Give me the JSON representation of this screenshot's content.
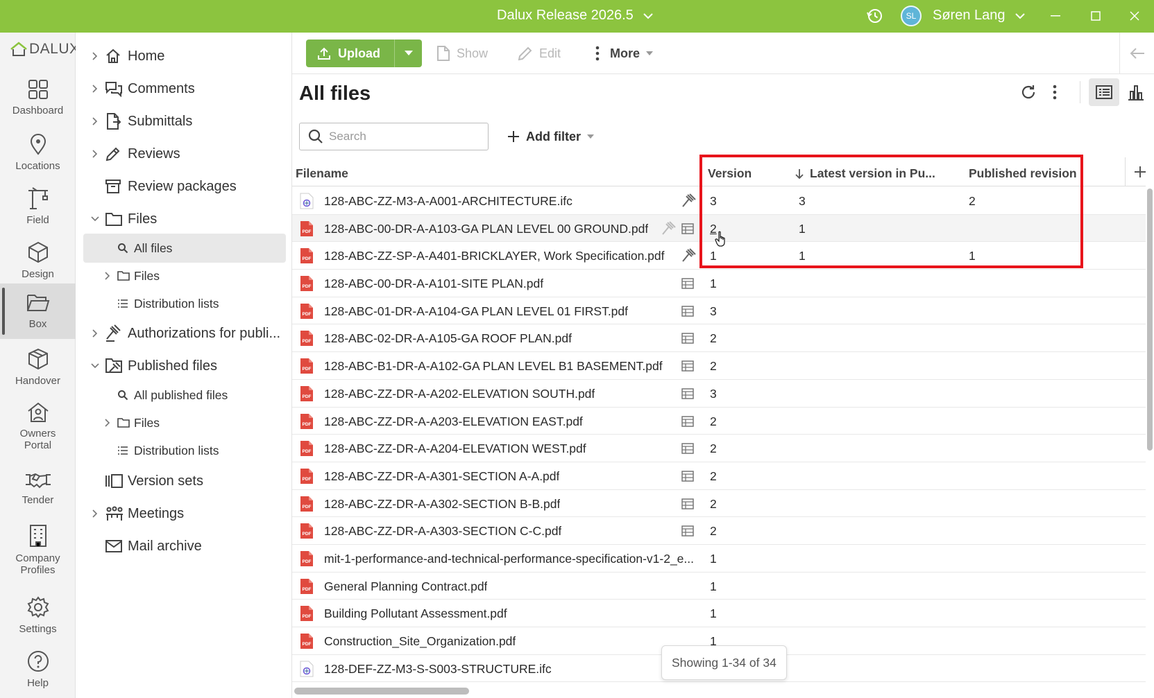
{
  "window": {
    "title": "Dalux Release 2026.5",
    "user_initials": "SL",
    "user_name": "Søren Lang"
  },
  "rail": {
    "logo_text": "DALUX",
    "items": [
      {
        "label": "Dashboard",
        "icon": "dashboard-icon"
      },
      {
        "label": "Locations",
        "icon": "location-pin-icon"
      },
      {
        "label": "Field",
        "icon": "crane-icon"
      },
      {
        "label": "Design",
        "icon": "cube-icon"
      },
      {
        "label": "Box",
        "icon": "folder-open-icon",
        "active": true
      },
      {
        "label": "Handover",
        "icon": "box-icon"
      },
      {
        "label": "Owners\nPortal",
        "icon": "house-user-icon"
      },
      {
        "label": "Tender",
        "icon": "handshake-icon"
      },
      {
        "label": "Company\nProfiles",
        "icon": "building-icon"
      },
      {
        "label": "Settings",
        "icon": "gear-icon"
      },
      {
        "label": "Help",
        "icon": "help-circle-icon"
      }
    ]
  },
  "tree": {
    "items": [
      {
        "label": "Home",
        "icon": "home-icon"
      },
      {
        "label": "Comments",
        "icon": "comments-icon"
      },
      {
        "label": "Submittals",
        "icon": "submittals-icon"
      },
      {
        "label": "Reviews",
        "icon": "pencil-icon"
      },
      {
        "label": "Review packages",
        "icon": "package-icon"
      },
      {
        "label": "Files",
        "icon": "folder-icon"
      },
      {
        "label": "All files",
        "icon": "search-icon"
      },
      {
        "label": "Files",
        "icon": "folder-icon"
      },
      {
        "label": "Distribution lists",
        "icon": "list-icon"
      },
      {
        "label": "Authorizations for publi...",
        "icon": "gavel-icon"
      },
      {
        "label": "Published files",
        "icon": "published-icon"
      },
      {
        "label": "All published files",
        "icon": "search-icon"
      },
      {
        "label": "Files",
        "icon": "folder-icon"
      },
      {
        "label": "Distribution lists",
        "icon": "list-icon"
      },
      {
        "label": "Version sets",
        "icon": "version-sets-icon"
      },
      {
        "label": "Meetings",
        "icon": "meetings-icon"
      },
      {
        "label": "Mail archive",
        "icon": "mail-icon"
      }
    ]
  },
  "toolbar": {
    "upload": "Upload",
    "show": "Show",
    "edit": "Edit",
    "more": "More"
  },
  "page": {
    "title": "All files",
    "search_placeholder": "Search",
    "add_filter": "Add filter"
  },
  "table": {
    "columns": {
      "filename": "Filename",
      "version": "Version",
      "latest": "Latest version in Pu...",
      "published": "Published revision"
    },
    "rows": [
      {
        "name": "128-ABC-ZZ-M3-A-A001-ARCHITECTURE.ifc",
        "type": "ifc",
        "version": "3",
        "latest": "3",
        "published": "2",
        "icons": [
          "gavel"
        ]
      },
      {
        "name": "128-ABC-00-DR-A-A103-GA PLAN LEVEL 00 GROUND.pdf",
        "type": "pdf",
        "version": "2",
        "latest": "1",
        "published": "",
        "icons": [
          "gavel-light",
          "sheet"
        ]
      },
      {
        "name": "128-ABC-ZZ-SP-A-A401-BRICKLAYER, Work Specification.pdf",
        "type": "pdf",
        "version": "1",
        "latest": "1",
        "published": "1",
        "icons": [
          "gavel"
        ]
      },
      {
        "name": "128-ABC-00-DR-A-A101-SITE PLAN.pdf",
        "type": "pdf",
        "version": "1",
        "latest": "",
        "published": "",
        "icons": [
          "sheet"
        ]
      },
      {
        "name": "128-ABC-01-DR-A-A104-GA PLAN LEVEL 01 FIRST.pdf",
        "type": "pdf",
        "version": "3",
        "latest": "",
        "published": "",
        "icons": [
          "sheet"
        ]
      },
      {
        "name": "128-ABC-02-DR-A-A105-GA ROOF PLAN.pdf",
        "type": "pdf",
        "version": "2",
        "latest": "",
        "published": "",
        "icons": [
          "sheet"
        ]
      },
      {
        "name": "128-ABC-B1-DR-A-A102-GA PLAN LEVEL B1 BASEMENT.pdf",
        "type": "pdf",
        "version": "2",
        "latest": "",
        "published": "",
        "icons": [
          "sheet"
        ]
      },
      {
        "name": "128-ABC-ZZ-DR-A-A202-ELEVATION SOUTH.pdf",
        "type": "pdf",
        "version": "3",
        "latest": "",
        "published": "",
        "icons": [
          "sheet"
        ]
      },
      {
        "name": "128-ABC-ZZ-DR-A-A203-ELEVATION EAST.pdf",
        "type": "pdf",
        "version": "2",
        "latest": "",
        "published": "",
        "icons": [
          "sheet"
        ]
      },
      {
        "name": "128-ABC-ZZ-DR-A-A204-ELEVATION WEST.pdf",
        "type": "pdf",
        "version": "2",
        "latest": "",
        "published": "",
        "icons": [
          "sheet"
        ]
      },
      {
        "name": "128-ABC-ZZ-DR-A-A301-SECTION A-A.pdf",
        "type": "pdf",
        "version": "2",
        "latest": "",
        "published": "",
        "icons": [
          "sheet"
        ]
      },
      {
        "name": "128-ABC-ZZ-DR-A-A302-SECTION B-B.pdf",
        "type": "pdf",
        "version": "2",
        "latest": "",
        "published": "",
        "icons": [
          "sheet"
        ]
      },
      {
        "name": "128-ABC-ZZ-DR-A-A303-SECTION C-C.pdf",
        "type": "pdf",
        "version": "2",
        "latest": "",
        "published": "",
        "icons": [
          "sheet"
        ]
      },
      {
        "name": "mit-1-performance-and-technical-performance-specification-v1-2_e...",
        "type": "pdf",
        "version": "1",
        "latest": "",
        "published": "",
        "icons": []
      },
      {
        "name": "General Planning Contract.pdf",
        "type": "pdf",
        "version": "1",
        "latest": "",
        "published": "",
        "icons": []
      },
      {
        "name": "Building Pollutant Assessment.pdf",
        "type": "pdf",
        "version": "1",
        "latest": "",
        "published": "",
        "icons": []
      },
      {
        "name": "Construction_Site_Organization.pdf",
        "type": "pdf",
        "version": "1",
        "latest": "",
        "published": "",
        "icons": []
      },
      {
        "name": "128-DEF-ZZ-M3-S-S003-STRUCTURE.ifc",
        "type": "ifc",
        "version": "",
        "latest": "",
        "published": "",
        "icons": []
      }
    ],
    "status": "Showing 1-34 of 34"
  },
  "colors": {
    "brand_green": "#8cc43f",
    "upload_green": "#7ab648",
    "highlight_red": "#e8141b",
    "pdf_red": "#e04a3f"
  }
}
